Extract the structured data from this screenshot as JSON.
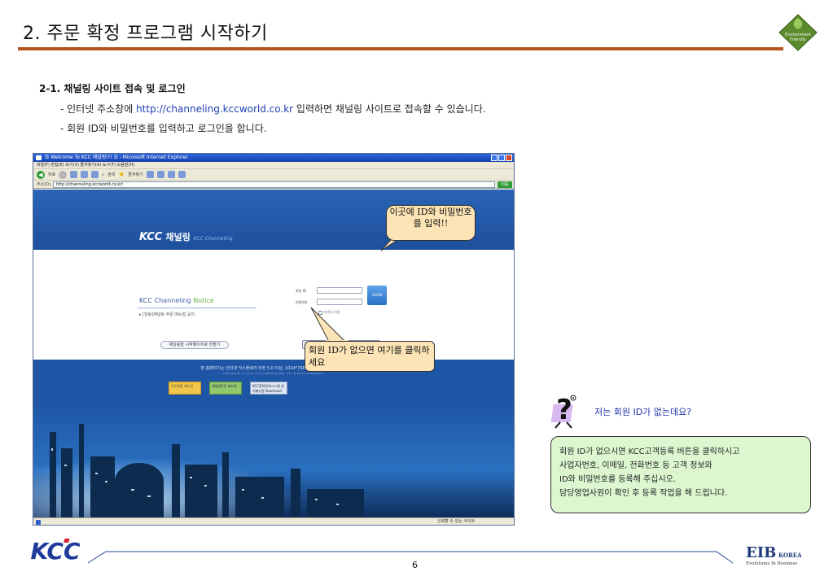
{
  "header": {
    "title": "2. 주문 확정 프로그램 시작하기",
    "badge_text_line1": "Environment",
    "badge_text_line2": "Friendly"
  },
  "section": {
    "heading": "2-1. 채널링 사이트 접속 및 로그인",
    "bullet1_prefix": "- 인터넷 주소창에 ",
    "bullet1_url": "http://channeling.kccworld.co.kr",
    "bullet1_suffix": " 입력하면 채널링 사이트로 접속할 수 있습니다.",
    "bullet2": "- 회원 ID와 비밀번호를 입력하고 로그인을 합니다."
  },
  "browser": {
    "window_title": "☰ Welcome To KCC 채널링!!! ☰ - Microsoft Internet Explorer",
    "menu": "파일(F)   편집(E)   보기(V)   즐겨찾기(A)   도구(T)   도움말(H)",
    "toolbar_back": "뒤로",
    "toolbar_search": "검색",
    "toolbar_favorites": "즐겨찾기",
    "address_label": "주소(D)",
    "address_value": "http://channeling.kccworld.co.kr/",
    "go_label": "이동",
    "site": {
      "logo": "KCC",
      "channel_ko": "채널링",
      "channel_en": "KCC Channeling",
      "notice_prefix": "KCC Channeling ",
      "notice_word": "Notice",
      "notice_item": "▸ [알림]채널링 주문 매뉴얼 공지",
      "start_page_button": "채널링을 시작페이지로 만들기",
      "id_label": "회원 ID",
      "pw_label": "비밀번호",
      "login_button": "LOGIN",
      "save_id": "아이디 저장",
      "register_customer_button": "KCC고객등록",
      "register_member_button": "KCC직원등록",
      "footer_text": "본 홈페이지는 인터넷 익스플로러 버전 5.0 이상, 1024*768에 최적화되어 있습니다.",
      "footer_copyright": "COPYRIGHT © 2004 KCC CORPORATION. ALL RIGHTS RESERVED.",
      "quick1": "주문제품 매뉴얼",
      "quick2": "채널링주문 매뉴얼",
      "quick3": "KCC협력관계시스템 설치매뉴얼 Download"
    },
    "status_zone": "신뢰할 수 있는 사이트"
  },
  "callouts": {
    "login_hint": "이곳에 ID와 비밀번호를 입력!!",
    "register_hint": "회원 ID가 없으면 여기를 클릭하세요"
  },
  "faq": {
    "question": "저는 회원 ID가 없는데요?",
    "answer_line1": "회원 ID가 없으시면 KCC고객등록 버튼을 클릭하시고",
    "answer_line2": "사업자번호, 이메일, 전화번호 등 고객 정보와",
    "answer_line3": "ID와 비밀번호를 등록해 주십시오.",
    "answer_line4": "담당영업사원이 확인 후 등록 작업을 해 드립니다."
  },
  "footer": {
    "logo": "KCC",
    "page_number": "6",
    "eib_main": "EIB",
    "eib_korea": "KOREA",
    "eib_tagline": "Evolutions In Business"
  },
  "colors": {
    "title_rule": "#b6541f",
    "site_blue": "#1e55a4",
    "callout_fill": "#fce4b6",
    "faq_box_fill": "#dcf7d0",
    "faq_question_text": "#2233aa",
    "url_link": "#1f3fb0"
  }
}
